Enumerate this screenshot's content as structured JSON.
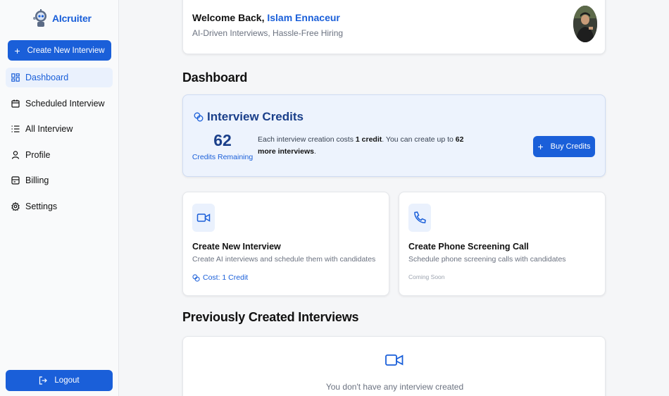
{
  "sidebar": {
    "logo_text": "AIcruiter",
    "create_button": "Create New Interview",
    "items": [
      {
        "label": "Dashboard",
        "icon": "dashboard-icon",
        "active": true
      },
      {
        "label": "Scheduled Interview",
        "icon": "calendar-icon"
      },
      {
        "label": "All Interview",
        "icon": "list-icon"
      },
      {
        "label": "Profile",
        "icon": "user-icon"
      },
      {
        "label": "Billing",
        "icon": "wallet-icon"
      },
      {
        "label": "Settings",
        "icon": "gear-icon"
      }
    ],
    "logout": "Logout"
  },
  "welcome": {
    "greeting": "Welcome Back,",
    "name": "Islam Ennaceur",
    "subtitle": "AI-Driven Interviews, Hassle-Free Hiring"
  },
  "dashboard": {
    "title": "Dashboard",
    "credits": {
      "title": "Interview Credits",
      "count": "62",
      "label": "Credits Remaining",
      "desc_1": "Each interview creation costs ",
      "desc_cost": "1 credit",
      "desc_2": ". You can create up to ",
      "desc_more": "62 more interviews",
      "desc_3": ".",
      "buy_button": "Buy Credits"
    },
    "features": [
      {
        "title": "Create New Interview",
        "desc": "Create AI interviews and schedule them with candidates",
        "cost": "Cost: 1 Credit"
      },
      {
        "title": "Create Phone Screening Call",
        "desc": "Schedule phone screening calls with candidates",
        "status": "Coming Soon"
      }
    ],
    "previous_title": "Previously Created Interviews",
    "empty_text": "You don't have any interview created"
  },
  "colors": {
    "accent": "#1a5fd9",
    "credits_bg": "#edf3fd"
  }
}
